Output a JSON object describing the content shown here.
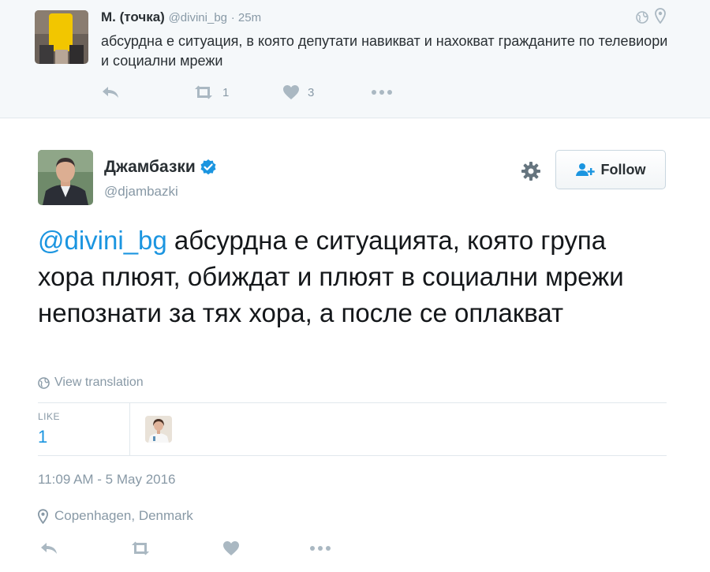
{
  "parent_tweet": {
    "display_name": "М. (точка)",
    "handle": "@divini_bg",
    "time": "25m",
    "text": "абсурдна е ситуация, в която депутати навикват и нахокват гражданите по телевиори и социални мрежи",
    "retweet_count": "1",
    "like_count": "3",
    "icons": [
      "globe-icon",
      "location-pin-icon",
      "reply-icon",
      "retweet-icon",
      "heart-icon",
      "more-icon"
    ]
  },
  "tweet": {
    "display_name": "Джамбазки",
    "handle": "@djambazki",
    "verified": true,
    "follow_label": "Follow",
    "mention": "@divini_bg",
    "text": " абсурдна е ситуацията, която група хора плюят, обиждат и плюят в социални мрежи непознати за тях хора, а после се оплакват",
    "translate_label": "View translation",
    "like_label": "LIKE",
    "like_count": "1",
    "timestamp": "11:09 AM - 5 May 2016",
    "location": "Copenhagen, Denmark",
    "icons": [
      "gear-icon",
      "follow-person-icon",
      "verified-badge-icon",
      "globe-icon",
      "location-pin-icon",
      "reply-icon",
      "retweet-icon",
      "heart-icon",
      "more-icon"
    ]
  },
  "colors": {
    "link_blue": "#1b95e0",
    "secondary_gray": "#8899a6",
    "icon_gray": "#aab8c2",
    "parent_background": "#f5f8fa",
    "border": "#e1e8ed"
  }
}
